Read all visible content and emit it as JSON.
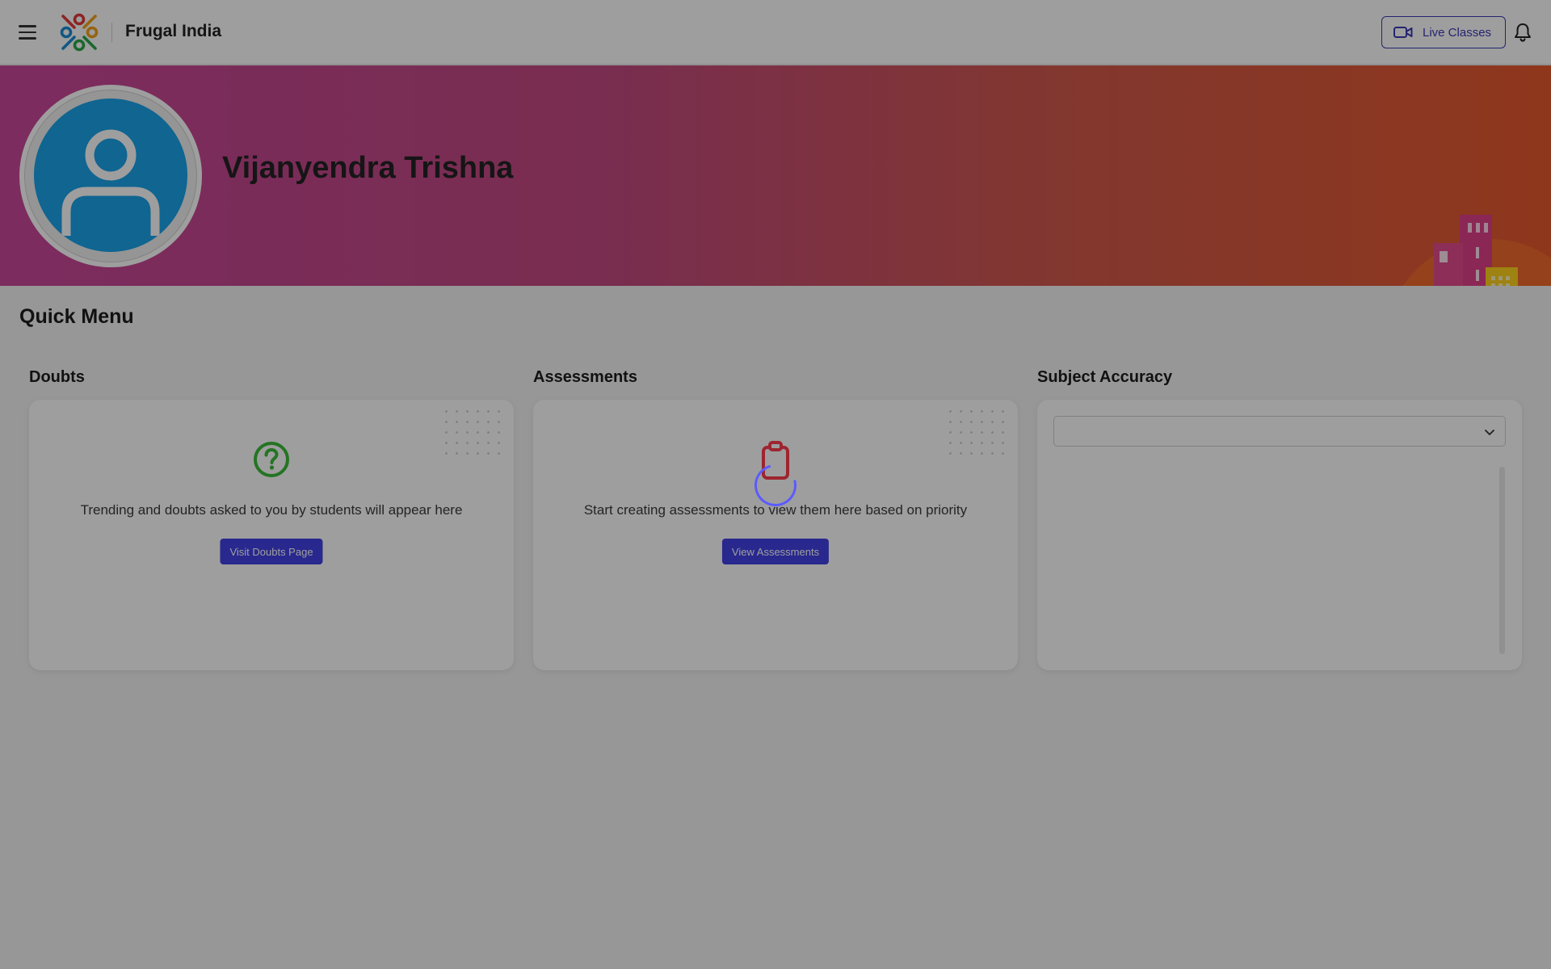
{
  "header": {
    "brand": "Frugal India",
    "live_classes_label": "Live Classes",
    "icons": {
      "menu": "hamburger-menu-icon",
      "logo": "frugal-india-logo",
      "live": "video-camera-icon",
      "notifications": "bell-icon"
    },
    "accent_color": "#3a3ab6"
  },
  "profile": {
    "name": "Vijanyendra Trishna",
    "avatar_icon": "user-avatar-icon",
    "banner_colors": [
      "#c8479a",
      "#e75a2f"
    ]
  },
  "quick_menu": {
    "title": "Quick Menu",
    "doubts": {
      "title": "Doubts",
      "icon": "question-circle-icon",
      "message": "Trending and doubts asked to you by students will appear here",
      "button_label": "Visit Doubts Page"
    },
    "assessments": {
      "title": "Assessments",
      "icon": "clipboard-icon",
      "message": "Start creating assessments to view them here based on priority",
      "button_label": "View Assessments"
    },
    "subject_accuracy": {
      "title": "Subject Accuracy",
      "select_value": "",
      "select_icon": "chevron-down-icon"
    }
  },
  "status": {
    "loading": true,
    "spinner_icon": "loading-spinner-icon",
    "button_color": "#4141e6"
  }
}
